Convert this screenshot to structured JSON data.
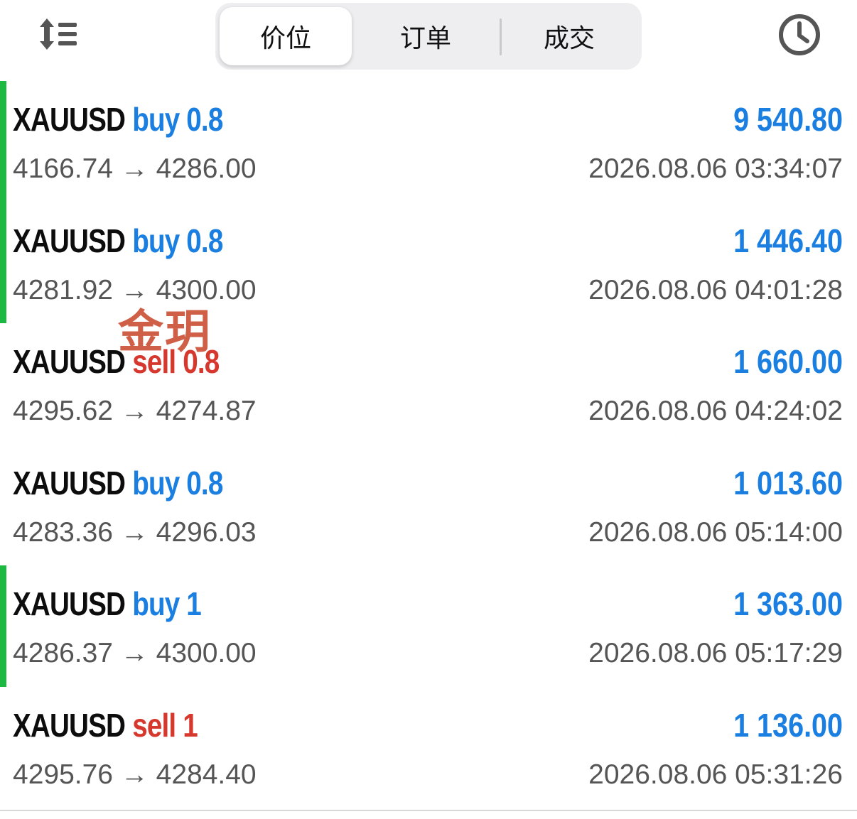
{
  "header": {
    "sort_icon": "sort-list-icon",
    "tabs": [
      {
        "label": "价位",
        "selected": true
      },
      {
        "label": "订单",
        "selected": false
      },
      {
        "label": "成交",
        "selected": false
      }
    ],
    "history_icon": "clock-icon"
  },
  "colors": {
    "buy": "#1a7fe0",
    "sell": "#d6382e",
    "profit": "#1a7fe0",
    "indicator": "#1cb942",
    "muted_text": "#555555"
  },
  "deals": [
    {
      "symbol": "XAUUSD",
      "side": "buy 0.8",
      "type": "buy",
      "prices": "4166.74 → 4286.00",
      "profit": "9 540.80",
      "time": "2026.08.06 03:34:07",
      "indicator": true
    },
    {
      "symbol": "XAUUSD",
      "side": "buy 0.8",
      "type": "buy",
      "prices": "4281.92 → 4300.00",
      "profit": "1 446.40",
      "time": "2026.08.06 04:01:28",
      "indicator": true
    },
    {
      "symbol": "XAUUSD",
      "side": "sell 0.8",
      "type": "sell",
      "prices": "4295.62 → 4274.87",
      "profit": "1 660.00",
      "time": "2026.08.06 04:24:02",
      "indicator": false
    },
    {
      "symbol": "XAUUSD",
      "side": "buy 0.8",
      "type": "buy",
      "prices": "4283.36 → 4296.03",
      "profit": "1 013.60",
      "time": "2026.08.06 05:14:00",
      "indicator": false
    },
    {
      "symbol": "XAUUSD",
      "side": "buy 1",
      "type": "buy",
      "prices": "4286.37 → 4300.00",
      "profit": "1 363.00",
      "time": "2026.08.06 05:17:29",
      "indicator": true
    },
    {
      "symbol": "XAUUSD",
      "side": "sell 1",
      "type": "sell",
      "prices": "4295.76 → 4284.40",
      "profit": "1 136.00",
      "time": "2026.08.06 05:31:26",
      "indicator": false
    }
  ],
  "watermark": "金玥"
}
